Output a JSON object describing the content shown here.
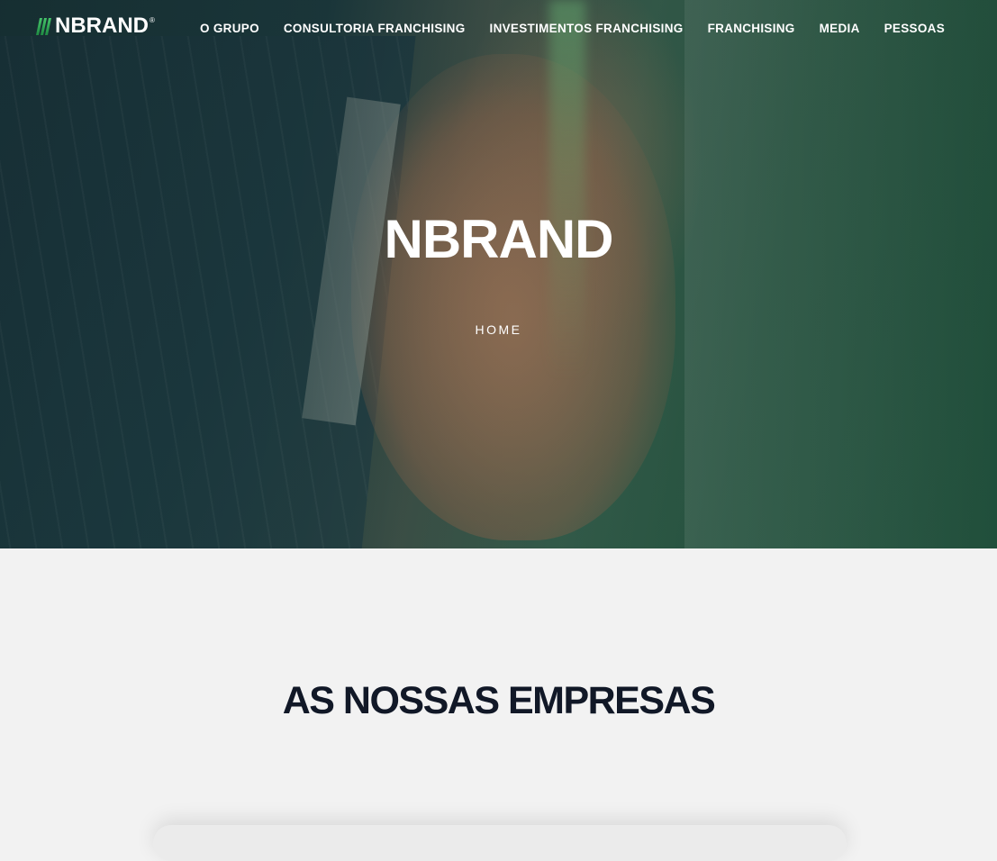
{
  "brand": {
    "logo_text": "NBRAND",
    "logo_registered": "®",
    "accent_color": "#2fae57"
  },
  "nav": {
    "items": [
      {
        "label": "O GRUPO"
      },
      {
        "label": "CONSULTORIA FRANCHISING"
      },
      {
        "label": "INVESTIMENTOS FRANCHISING"
      },
      {
        "label": "FRANCHISING"
      },
      {
        "label": "MEDIA"
      },
      {
        "label": "PESSOAS"
      }
    ]
  },
  "hero": {
    "title": "NBRAND",
    "breadcrumb": "HOME"
  },
  "section": {
    "title": "AS NOSSAS EMPRESAS"
  }
}
